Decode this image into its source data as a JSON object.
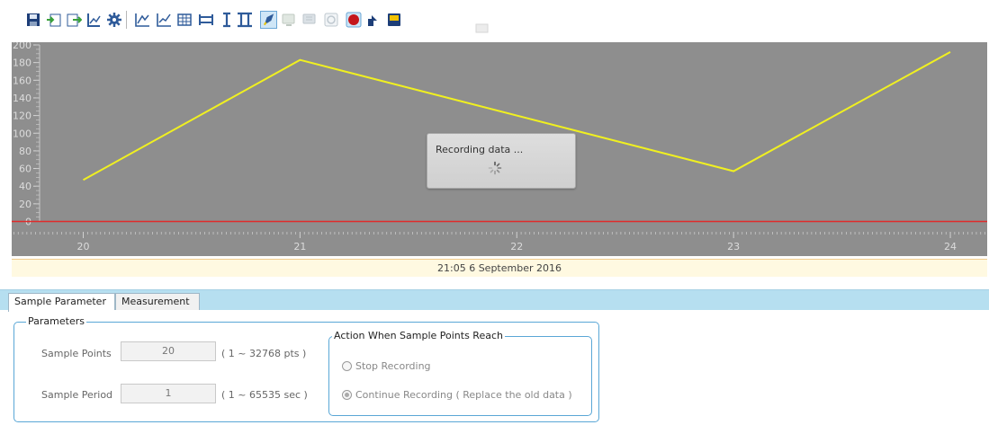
{
  "toolbar": {
    "buttons": [
      {
        "name": "save-icon"
      },
      {
        "name": "import-icon"
      },
      {
        "name": "export-icon"
      },
      {
        "name": "chart-settings-icon"
      },
      {
        "name": "gear-icon"
      },
      {
        "name": "axis-scale-icon"
      },
      {
        "name": "axis-auto-icon"
      },
      {
        "name": "grid-icon"
      },
      {
        "name": "range-icon"
      },
      {
        "name": "cursor-single-icon"
      },
      {
        "name": "cursor-double-icon"
      },
      {
        "name": "pen-icon",
        "pressed": true
      },
      {
        "name": "monitor-icon",
        "disabled": true
      },
      {
        "name": "monitor-list-icon",
        "disabled": true
      },
      {
        "name": "refresh-icon",
        "disabled": true
      },
      {
        "name": "record-icon"
      },
      {
        "name": "upload-icon"
      },
      {
        "name": "device-icon"
      },
      {
        "name": "small-disabled-icon",
        "disabled": true
      }
    ]
  },
  "chart_data": {
    "type": "line",
    "x": [
      20,
      21,
      23,
      24
    ],
    "y_range": [
      0,
      200
    ],
    "y_ticks": [
      "200",
      "180",
      "160",
      "140",
      "120",
      "100",
      "80",
      "60",
      "40",
      "20",
      "0"
    ],
    "x_ticks": [
      "20",
      "21",
      "22",
      "23",
      "24"
    ],
    "xlim": [
      19.67,
      24.17
    ],
    "series": [
      {
        "values": [
          47,
          183,
          57,
          192
        ],
        "color": "#f0f020"
      },
      {
        "values": [
          0,
          0,
          0,
          0
        ],
        "color": "#e02a2a"
      }
    ],
    "background": "#8e8e8e"
  },
  "chart": {
    "timestamp": "21:05 6 September 2016",
    "overlay_text": "Recording data ..."
  },
  "tabs": {
    "sample": "Sample Parameter",
    "measure": "Measurement"
  },
  "params": {
    "legend": "Parameters",
    "points_label": "Sample Points",
    "points_value": "20",
    "points_range": "( 1 ~ 32768 pts )",
    "period_label": "Sample Period",
    "period_value": "1",
    "period_range": "( 1 ~ 65535 sec )"
  },
  "action": {
    "legend": "Action When Sample Points Reach",
    "stop": "Stop Recording",
    "continue": "Continue Recording ( Replace the old data )"
  }
}
